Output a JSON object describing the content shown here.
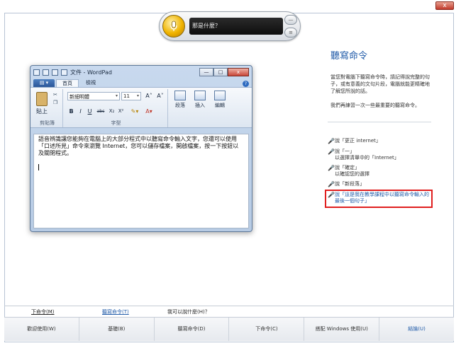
{
  "window": {
    "close_glyph": "x"
  },
  "speech_bar": {
    "display_text": "那是什麼？",
    "mic_icon": "microphone-icon",
    "minimize_glyph": "—",
    "options_glyph": "≡"
  },
  "wordpad": {
    "title": "文件 - WordPad",
    "file_button": "▤ ▾",
    "tabs": [
      "首頁",
      "檢視"
    ],
    "help_glyph": "?",
    "window_controls": [
      "—",
      "□",
      "x"
    ],
    "clipboard": {
      "paste_label": "貼上",
      "group_label": "剪貼簿"
    },
    "font": {
      "family": "新細明體",
      "size": "11",
      "grow": "A˄",
      "shrink": "A˅",
      "buttons": [
        "B",
        "I",
        "U",
        "abc",
        "X₂",
        "X²"
      ],
      "group_label": "字型"
    },
    "paragraph": {
      "label": "段落"
    },
    "insert": {
      "label": "插入"
    },
    "editing": {
      "label": "編輯"
    },
    "document_text": "語音辨識讓您能夠在電腦上的大部分程式中以聽寫命令輸入文字，您還可以使用「口述所見」命令來瀏覽 Internet，您可以儲存檔案，開啟檔案，按一下按鈕以及關閉程式。"
  },
  "panel": {
    "title": "聽寫命令",
    "intro": "當您對電腦下聽寫命令時，請記得說完整的句子，或有意義的文句片段，電腦就能更精確地了解您所說的話。",
    "subtitle": "我們再練習一次一些最重要的聽寫命令。",
    "commands": [
      {
        "text": "說「更正 internet」"
      },
      {
        "text": "說「一」",
        "sub": "以選擇清單中的「Internet」"
      },
      {
        "text": "說「確定」",
        "sub": "以確認您的選擇"
      },
      {
        "text": "說「新段落」"
      },
      {
        "text": "說「這是我在教學課程中以聽寫命令輸入的最後一個句子」"
      }
    ]
  },
  "steps": {
    "prev": "下命令(M)",
    "current": "聽寫命令(T)",
    "next": "我可以說什麼(H)？"
  },
  "nav": [
    "歡迎使用(W)",
    "基礎(B)",
    "聽寫命令(D)",
    "下命令(C)",
    "搭配 Windows 使用(U)",
    "結論(U)"
  ]
}
